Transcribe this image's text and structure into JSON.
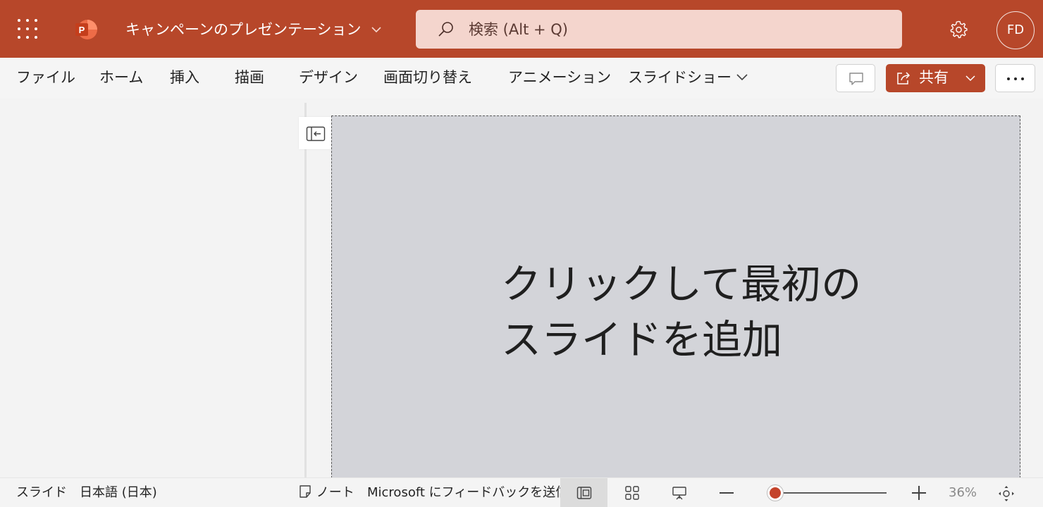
{
  "app": {
    "title": "キャンペーンのプレゼンテーション",
    "logo_letter": "P",
    "brand_color": "#b7472a"
  },
  "search": {
    "placeholder": "検索 (Alt + Q)"
  },
  "user": {
    "initials": "FD"
  },
  "ribbon": {
    "tabs": [
      {
        "label": "ファイル"
      },
      {
        "label": "ホーム"
      },
      {
        "label": "挿入"
      },
      {
        "label": "描画"
      },
      {
        "label": "デザイン"
      },
      {
        "label": "画面切り替え"
      },
      {
        "label": "アニメーション"
      },
      {
        "label": "スライドショー"
      }
    ],
    "share_label": "共有"
  },
  "slide": {
    "placeholder_text": "クリックして最初のスライドを追加"
  },
  "status": {
    "slide_label": "スライド",
    "language": "日本語 (日本)",
    "notes_label": "ノート",
    "feedback": "Microsoft にフィードバックを送信",
    "zoom": "36%",
    "zoom_level": 0.05
  },
  "icons": [
    "app-launcher-icon",
    "powerpoint-logo-icon",
    "chevron-down-icon",
    "search-icon",
    "gear-icon",
    "comment-icon",
    "share-icon",
    "more-icon",
    "collapse-pane-icon",
    "notes-icon",
    "normal-view-icon",
    "slide-sorter-icon",
    "reading-view-icon",
    "fit-slide-icon"
  ]
}
